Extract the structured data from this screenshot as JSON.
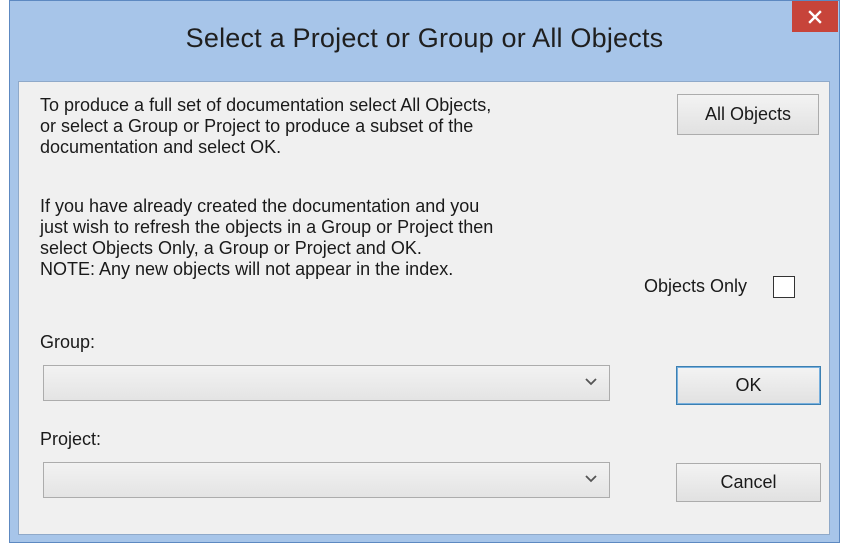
{
  "window": {
    "title": "Select a Project or Group or All Objects",
    "close_glyph": "✕"
  },
  "intro": {
    "paragraph1": "To produce a full set of documentation select All Objects,\nor select a Group or Project to produce a subset of the\ndocumentation and select OK.",
    "paragraph2": "If you have already created the documentation and you\njust wish to refresh the objects in a Group or Project then\nselect Objects Only, a Group or Project and OK.\n NOTE: Any new objects will not appear in the index."
  },
  "buttons": {
    "all_objects": "All Objects",
    "ok": "OK",
    "cancel": "Cancel"
  },
  "objects_only": {
    "label": "Objects Only",
    "checked": false
  },
  "group": {
    "label": "Group:",
    "value": ""
  },
  "project": {
    "label": "Project:",
    "value": ""
  },
  "icons": {
    "close": "close-icon",
    "dropdown": "chevron-down-icon"
  },
  "colors": {
    "frame": "#a7c5e9",
    "close_button": "#c7443a",
    "client_background": "#f0f0f0"
  }
}
